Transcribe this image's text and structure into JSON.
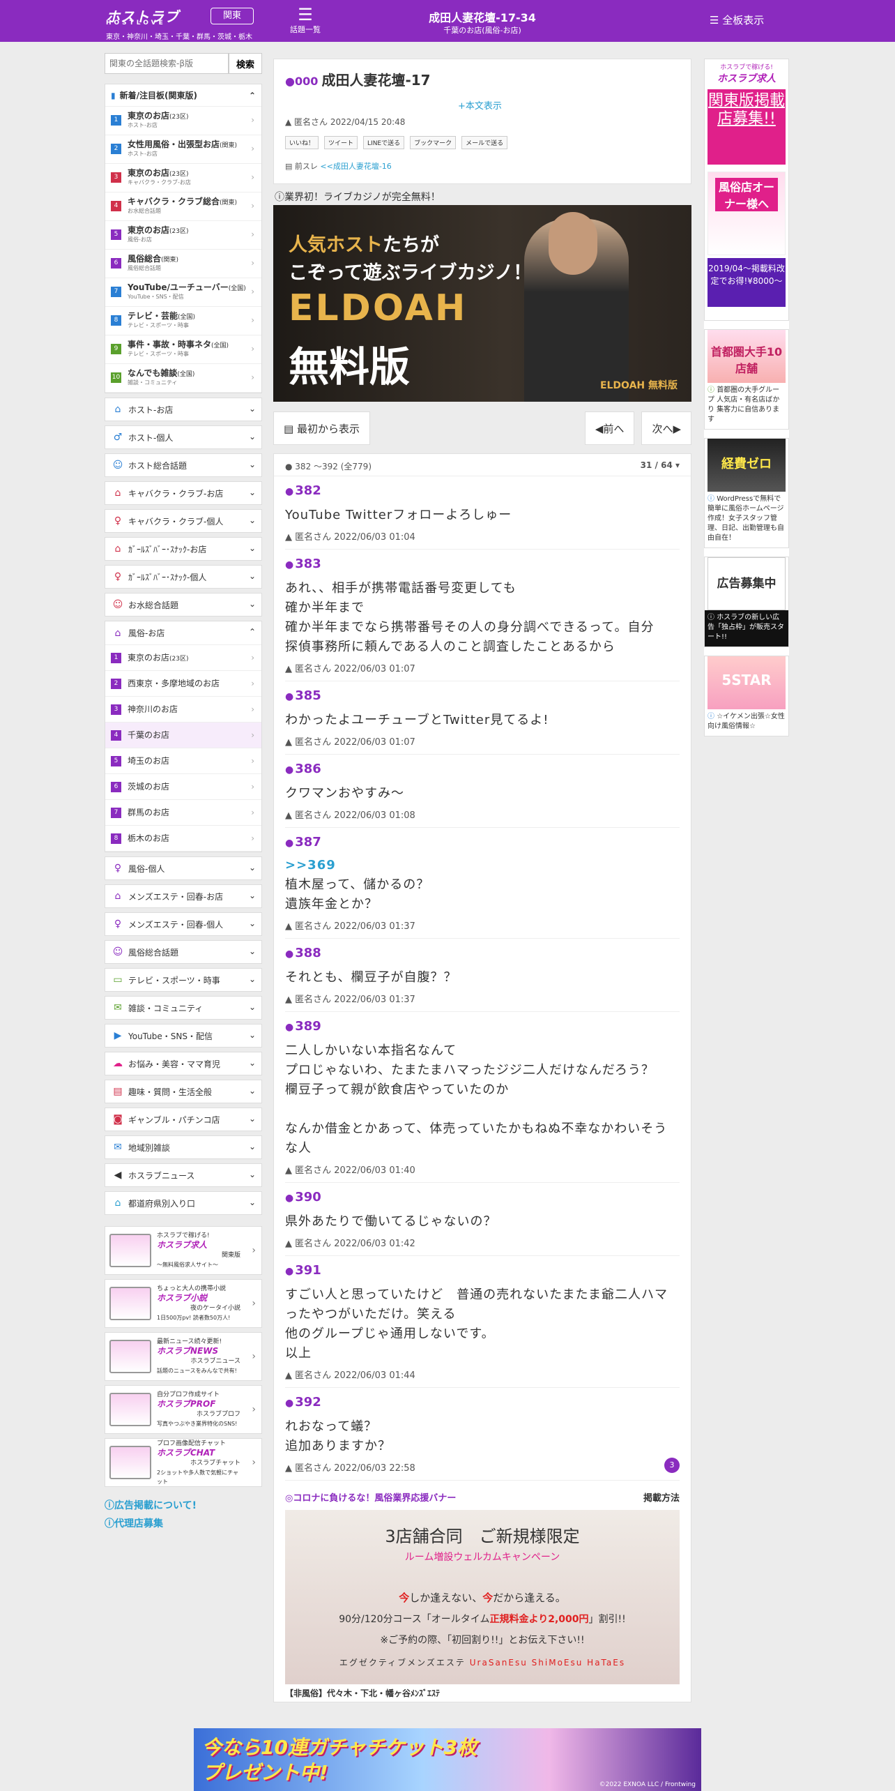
{
  "header": {
    "logo": "ホストラブ",
    "logo_sub": "HOSTLOVE",
    "area_button": "関東",
    "areas": "東京・神奈川・埼玉・千葉・群馬・茨城・栃木",
    "topics_label": "話題一覧",
    "title": "成田人妻花壇-17-34",
    "subtitle": "千葉のお店(風俗-お店)",
    "all_label": "全板表示"
  },
  "search": {
    "placeholder": "関東の全話題検索-β版",
    "button": "検索"
  },
  "sidebar": {
    "new_heading": "新着/注目板(関東版)",
    "new_items": [
      {
        "num": "1",
        "color": "#2a7fd4",
        "title": "東京のお店",
        "tag": "(23区)",
        "sub": "ホスト-お店"
      },
      {
        "num": "2",
        "color": "#2a7fd4",
        "title": "女性用風俗・出張型お店",
        "tag": "(関東)",
        "sub": "ホスト-お店"
      },
      {
        "num": "3",
        "color": "#d0304a",
        "title": "東京のお店",
        "tag": "(23区)",
        "sub": "キャバクラ・クラブ-お店"
      },
      {
        "num": "4",
        "color": "#d0304a",
        "title": "キャバクラ・クラブ総合",
        "tag": "(関東)",
        "sub": "お水総合話題"
      },
      {
        "num": "5",
        "color": "#8a2bbf",
        "title": "東京のお店",
        "tag": "(23区)",
        "sub": "風俗-お店"
      },
      {
        "num": "6",
        "color": "#8a2bbf",
        "title": "風俗総合",
        "tag": "(関東)",
        "sub": "風俗総合話題"
      },
      {
        "num": "7",
        "color": "#2a7fd4",
        "title": "YouTube/ユーチューバー",
        "tag": "(全国)",
        "sub": "YouTube・SNS・配信"
      },
      {
        "num": "8",
        "color": "#2a7fd4",
        "title": "テレビ・芸能",
        "tag": "(全国)",
        "sub": "テレビ・スポーツ・時事"
      },
      {
        "num": "9",
        "color": "#5aa02c",
        "title": "事件・事故・時事ネタ",
        "tag": "(全国)",
        "sub": "テレビ・スポーツ・時事"
      },
      {
        "num": "10",
        "color": "#5aa02c",
        "title": "なんでも雑談",
        "tag": "(全国)",
        "sub": "雑談・コミュニティ"
      }
    ],
    "cats_a": [
      {
        "label": "ホスト-お店",
        "icon": "⌂",
        "color": "#2a7fd4"
      },
      {
        "label": "ホスト-個人",
        "icon": "♂",
        "color": "#2a7fd4"
      },
      {
        "label": "ホスト総合話題",
        "icon": "☺",
        "color": "#2a7fd4"
      },
      {
        "label": "キャバクラ・クラブ-お店",
        "icon": "⌂",
        "color": "#d0304a"
      },
      {
        "label": "キャバクラ・クラブ-個人",
        "icon": "♀",
        "color": "#d0304a"
      },
      {
        "label": "ｶﾞｰﾙｽﾞﾊﾞｰ･ｽﾅｯｸ-お店",
        "icon": "⌂",
        "color": "#d0304a"
      },
      {
        "label": "ｶﾞｰﾙｽﾞﾊﾞｰ･ｽﾅｯｸ-個人",
        "icon": "♀",
        "color": "#d0304a"
      },
      {
        "label": "お水総合話題",
        "icon": "☺",
        "color": "#d0304a"
      }
    ],
    "fuzoku_open": "風俗-お店",
    "fuzoku_subs": [
      {
        "num": "1",
        "label": "東京のお店",
        "tag": "(23区)"
      },
      {
        "num": "2",
        "label": "西東京・多摩地域のお店",
        "tag": ""
      },
      {
        "num": "3",
        "label": "神奈川のお店",
        "tag": ""
      },
      {
        "num": "4",
        "label": "千葉のお店",
        "tag": ""
      },
      {
        "num": "5",
        "label": "埼玉のお店",
        "tag": ""
      },
      {
        "num": "6",
        "label": "茨城のお店",
        "tag": ""
      },
      {
        "num": "7",
        "label": "群馬のお店",
        "tag": ""
      },
      {
        "num": "8",
        "label": "栃木のお店",
        "tag": ""
      }
    ],
    "cats_b": [
      {
        "label": "風俗-個人",
        "icon": "♀",
        "color": "#8a2bbf"
      },
      {
        "label": "メンズエステ・回春-お店",
        "icon": "⌂",
        "color": "#8a2bbf"
      },
      {
        "label": "メンズエステ・回春-個人",
        "icon": "♀",
        "color": "#8a2bbf"
      },
      {
        "label": "風俗総合話題",
        "icon": "☺",
        "color": "#8a2bbf"
      },
      {
        "label": "テレビ・スポーツ・時事",
        "icon": "▭",
        "color": "#5aa02c"
      },
      {
        "label": "雑談・コミュニティ",
        "icon": "✉",
        "color": "#5aa02c"
      },
      {
        "label": "YouTube・SNS・配信",
        "icon": "▶",
        "color": "#2a7fd4"
      },
      {
        "label": "お悩み・美容・ママ育児",
        "icon": "☁",
        "color": "#e0208a"
      },
      {
        "label": "趣味・質問・生活全般",
        "icon": "▤",
        "color": "#d0304a"
      },
      {
        "label": "ギャンブル・パチンコ店",
        "icon": "◙",
        "color": "#d0304a"
      },
      {
        "label": "地域別雑談",
        "icon": "✉",
        "color": "#2a7fd4"
      },
      {
        "label": "ホスラブニュース",
        "icon": "◀",
        "color": "#333"
      },
      {
        "label": "都道府県別入り口",
        "icon": "⌂",
        "color": "#2a9fd0"
      }
    ],
    "promos": [
      {
        "top": "ホスラブで稼げる!",
        "name": "ホスラブ求人",
        "desc": "関東版",
        "desc2": "〜無料風俗求人サイト〜"
      },
      {
        "top": "ちょっと大人の携帯小説",
        "name": "ホスラブ小説",
        "desc": "夜のケータイ小説",
        "desc2": "1日500万pv! 読者数50万人!"
      },
      {
        "top": "最新ニュース続々更新!",
        "name": "ホスラブNEWS",
        "desc": "ホスラブニュース",
        "desc2": "話題のニュースをみんなで共有!"
      },
      {
        "top": "自分プロフ作成サイト",
        "name": "ホスラブPROF",
        "desc": "ホスラブプロフ",
        "desc2": "写真やつぶやき業界特化のSNS!"
      },
      {
        "top": "プロフ画像配信チャット",
        "name": "ホスラブCHAT",
        "desc": "ホスラブチャット",
        "desc2": "2ショットや多人数で気軽にチャット"
      }
    ],
    "link1": "広告掲載について!",
    "link2": "代理店募集"
  },
  "thread": {
    "num": "000",
    "title": "成田人妻花壇-17",
    "honbun": "+本文表示",
    "author": "匿名さん 2022/04/15 20:48",
    "share": [
      "いいね！",
      "ツイート",
      "LINEで送る",
      "ブックマーク",
      "メールで送る"
    ],
    "prev_label": "前スレ",
    "prev_link": "<<成田人妻花壇-16"
  },
  "ad_top": {
    "caption": "業界初！ライブカジノが完全無料！",
    "line1a": "人気",
    "line1b": "ホスト",
    "line1c": "たちが",
    "line2": "こぞって遊ぶライブカジノ！",
    "brand": "ELDOAH",
    "free": "無料版",
    "logo": "ELDOAH 無料版"
  },
  "nav": {
    "from_start": "最初から表示",
    "prev": "前へ",
    "next": "次へ"
  },
  "posts_head": {
    "range": "382 ～392 (全779)",
    "page": "31 / 64"
  },
  "posts": [
    {
      "num": "382",
      "body": "YouTube Twitterフォローよろしゅー",
      "author": "匿名さん 2022/06/03 01:04"
    },
    {
      "num": "383",
      "body": "あれ、、相手が携帯電話番号変更しても\n確か半年まで\n確か半年までなら携帯番号その人の身分調べできるって。自分　探偵事務所に頼んである人のこと調査したことあるから",
      "author": "匿名さん 2022/06/03 01:07"
    },
    {
      "num": "385",
      "body": "わかったよユーチューブとTwitter見てるよ!",
      "author": "匿名さん 2022/06/03 01:07"
    },
    {
      "num": "386",
      "body": "クワマンおやすみ〜",
      "author": "匿名さん 2022/06/03 01:08"
    },
    {
      "num": "387",
      "anchor": ">>369",
      "body": "植木屋って、儲かるの？\n遺族年金とか？",
      "author": "匿名さん 2022/06/03 01:37"
    },
    {
      "num": "388",
      "body": "それとも、欄豆子が自腹？？",
      "author": "匿名さん 2022/06/03 01:37"
    },
    {
      "num": "389",
      "body": "二人しかいない本指名なんて\nプロじゃないわ、たまたまハマったジジ二人だけなんだろう？\n欄豆子って親が飲食店やっていたのか\n\nなんか借金とかあって、体売っていたかもねぬ不幸なかわいそうな人",
      "author": "匿名さん 2022/06/03 01:40"
    },
    {
      "num": "390",
      "body": "県外あたりで働いてるじゃないの？",
      "author": "匿名さん 2022/06/03 01:42"
    },
    {
      "num": "391",
      "body": "すごい人と思っていたけど　普通の売れないたまたま爺二人ハマったやつがいただけ。笑える\n他のグループじゃ通用しないです。\n以上",
      "author": "匿名さん 2022/06/03 01:44"
    },
    {
      "num": "392",
      "body": "れおなって蟻？\n追加ありますか？",
      "author": "匿名さん 2022/06/03 22:58",
      "badge": "3"
    }
  ],
  "covid": {
    "title": "◎コロナに負けるな！風俗業界応援バナー",
    "method": "掲載方法"
  },
  "banner2": {
    "t1": "3店舗合同　ご新規様限定",
    "t2": "ルーム増設ウェルカムキャンペーン",
    "t3a": "今",
    "t3b": "しか逢えない、",
    "t3c": "今",
    "t3d": "だから逢える。",
    "t4a": "90分/120分コース「オールタイム",
    "t4b": "正規料金より2,000円",
    "t4c": "」割引!!",
    "t5": "※ご予約の際、「初回割り!!」とお伝え下さい!!",
    "t6a": "エグゼクティブメンズエステ",
    "t6b": "UraSanEsu ShiMoEsu HaTaEs",
    "cap": "【非風俗】代々木・下北・幡ヶ谷ﾒﾝｽﾞｴｽﾃ"
  },
  "rside": {
    "a1": "ホスラブで稼げる!",
    "a1b": "ホスラブ求人",
    "a1c": "関東版掲載店募集!!",
    "a1d": "風俗店オーナー様へ",
    "a1e": "2019/04〜掲載料改定でお得!¥8000〜",
    "b_txt": "首都圏大手10店舗",
    "b_desc": "首都圏の大手グループ 人気店・有名店ばかり 集客力に自信あります",
    "c_txt": "経費ゼロ",
    "c_desc": "WordPressで無料で簡単に風俗ホームページ作成！女子スタッフ管理、日記、出勤管理も自由自在！",
    "d_txt": "広告募集中",
    "d_desc": "ホスラブの新しい広告「独占枠」が販売スタート!!",
    "e_txt": "5STAR",
    "e_desc": "☆イケメン出張☆女性向け風俗情報☆"
  },
  "bottom_ad": {
    "line1": "今なら10連ガチャチケット3枚",
    "line2": "プレゼント中!",
    "foot": "©2022 EXNOA LLC / Frontwing"
  }
}
